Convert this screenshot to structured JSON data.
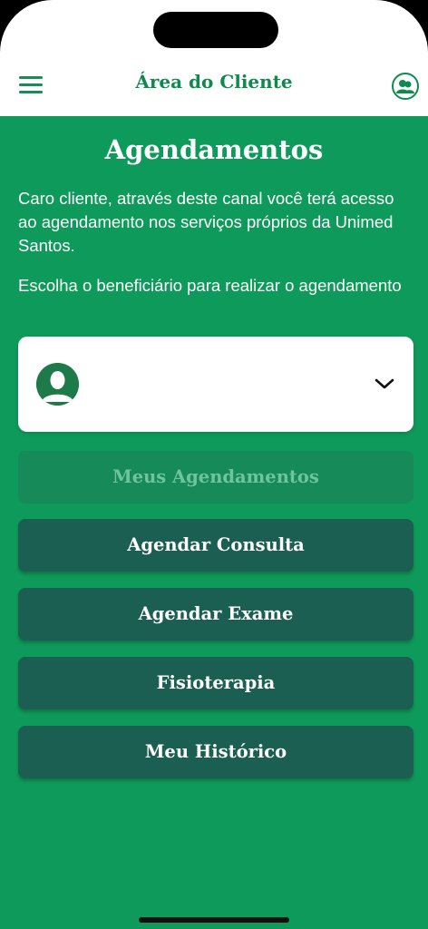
{
  "header": {
    "title": "Área do Cliente",
    "menu_icon": "hamburger-menu-icon",
    "profile_icon": "users-icon"
  },
  "main": {
    "title": "Agendamentos",
    "intro_text": "Caro cliente, através deste canal você terá acesso ao agendamento nos serviços próprios da Unimed Santos.",
    "choose_text": "Escolha o beneficiário para realizar o agendamento",
    "beneficiary_select": {
      "selected_value": "",
      "avatar_icon": "user-silhouette-icon",
      "dropdown_icon": "chevron-down-icon"
    },
    "buttons": {
      "my_appointments": "Meus Agendamentos",
      "schedule_consultation": "Agendar Consulta",
      "schedule_exam": "Agendar Exame",
      "physiotherapy": "Fisioterapia",
      "my_history": "Meu Histórico"
    }
  },
  "colors": {
    "brand_green": "#0e9a5a",
    "button_dark": "#1b5e52",
    "header_text": "#0e8a4f"
  }
}
